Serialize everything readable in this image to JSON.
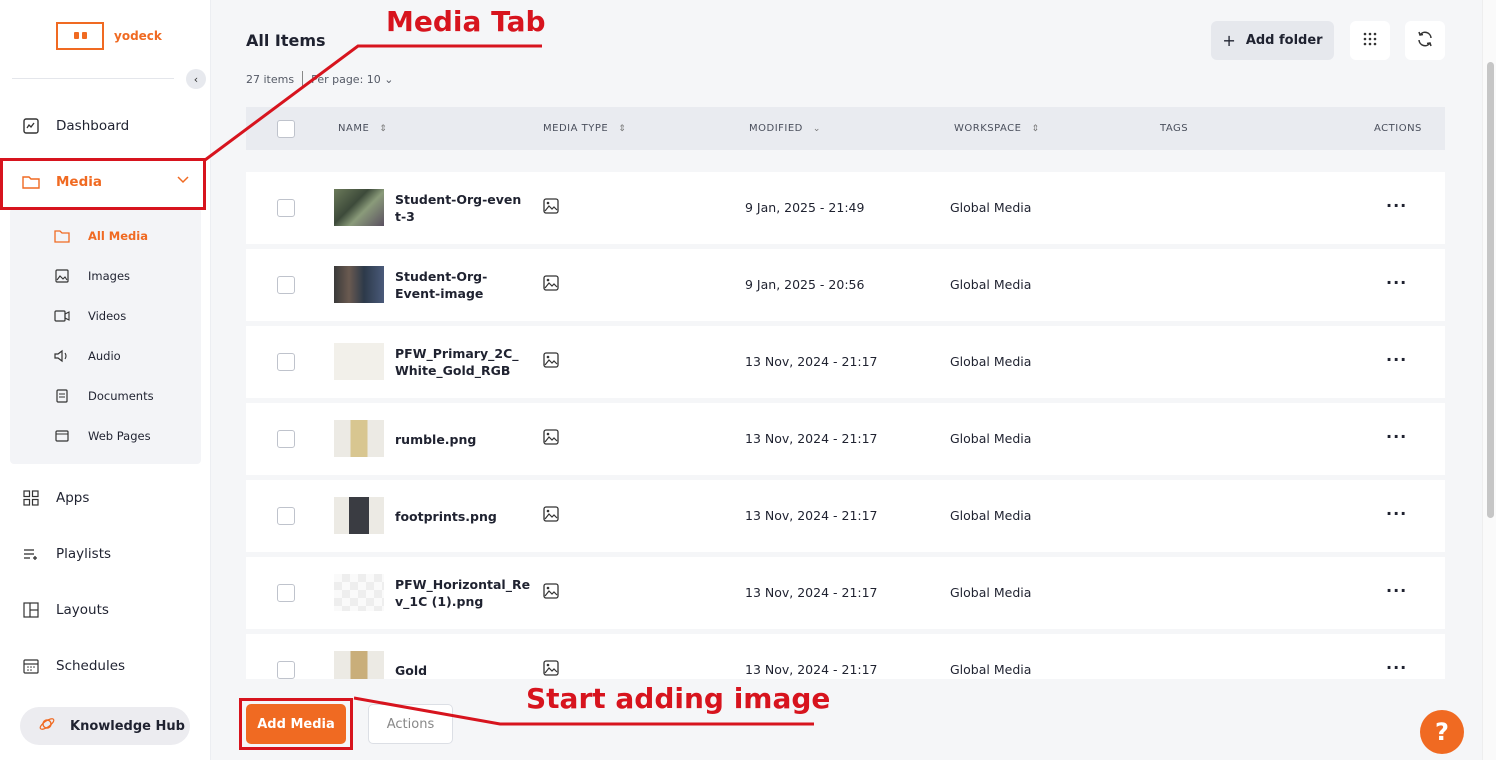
{
  "brand": {
    "name": "yodeck",
    "color": "#f06a22"
  },
  "sidebar": {
    "items": [
      {
        "label": "Dashboard",
        "icon": "dashboard-icon"
      },
      {
        "label": "Media",
        "icon": "folder-icon"
      },
      {
        "label": "Apps",
        "icon": "apps-icon"
      },
      {
        "label": "Playlists",
        "icon": "playlist-icon"
      },
      {
        "label": "Layouts",
        "icon": "layout-icon"
      },
      {
        "label": "Schedules",
        "icon": "calendar-icon"
      }
    ],
    "submenu": [
      {
        "label": "All Media",
        "icon": "folder-icon"
      },
      {
        "label": "Images",
        "icon": "image-icon"
      },
      {
        "label": "Videos",
        "icon": "video-icon"
      },
      {
        "label": "Audio",
        "icon": "speaker-icon"
      },
      {
        "label": "Documents",
        "icon": "document-icon"
      },
      {
        "label": "Web Pages",
        "icon": "webpage-icon"
      }
    ],
    "knowledge_hub": "Knowledge Hub"
  },
  "header": {
    "title": "All Items",
    "items_count": "27 items",
    "per_page_label": "Per page:",
    "per_page_value": "10",
    "add_folder": "Add folder"
  },
  "table": {
    "columns": {
      "name": "NAME",
      "media_type": "MEDIA TYPE",
      "modified": "MODIFIED",
      "workspace": "WORKSPACE",
      "tags": "TAGS",
      "actions": "ACTIONS"
    },
    "rows": [
      {
        "name": "Student-Org-even t-3",
        "modified": "9 Jan, 2025 - 21:49",
        "workspace": "Global Media"
      },
      {
        "name": "Student-Org-Event-image",
        "modified": "9 Jan, 2025 - 20:56",
        "workspace": "Global Media"
      },
      {
        "name": "PFW_Primary_2C_ White_Gold_RGB",
        "modified": "13 Nov, 2024 - 21:17",
        "workspace": "Global Media"
      },
      {
        "name": "rumble.png",
        "modified": "13 Nov, 2024 - 21:17",
        "workspace": "Global Media"
      },
      {
        "name": "footprints.png",
        "modified": "13 Nov, 2024 - 21:17",
        "workspace": "Global Media"
      },
      {
        "name": "PFW_Horizontal_Re v_1C (1).png",
        "modified": "13 Nov, 2024 - 21:17",
        "workspace": "Global Media"
      },
      {
        "name": "Gold",
        "modified": "13 Nov, 2024 - 21:17",
        "workspace": "Global Media"
      }
    ],
    "row_actions": "···"
  },
  "footer": {
    "add_media": "Add Media",
    "actions": "Actions",
    "help": "?"
  },
  "annotations": {
    "media_tab": "Media Tab",
    "start_adding": "Start adding image",
    "color": "#d7141e"
  }
}
